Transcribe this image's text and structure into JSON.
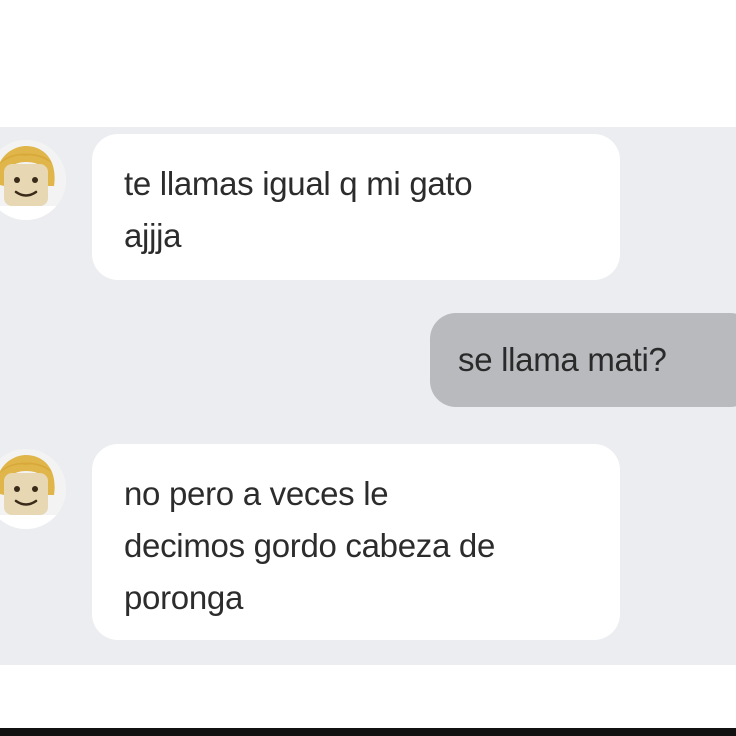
{
  "conversation": {
    "messages": [
      {
        "sender": "other",
        "lines": [
          "te llamas igual q mi gato",
          "ajjja"
        ]
      },
      {
        "sender": "me",
        "lines": [
          "se llama mati?"
        ]
      },
      {
        "sender": "other",
        "lines": [
          "no pero a veces le",
          "decimos gordo cabeza de",
          "poronga"
        ]
      }
    ]
  },
  "colors": {
    "chat_background": "#ecedf1",
    "incoming_bubble": "#ffffff",
    "outgoing_bubble": "#b8babe",
    "avatar_hair": "#e0b64a"
  },
  "icons": {
    "avatar": "roblox-avatar-icon"
  }
}
